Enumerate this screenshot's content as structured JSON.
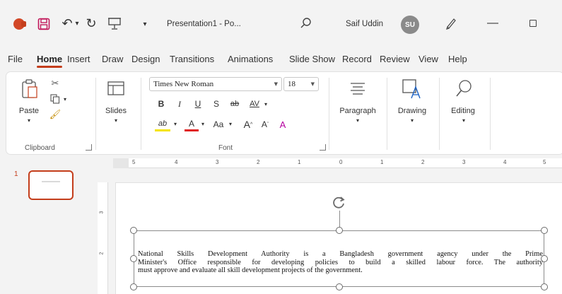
{
  "titlebar": {
    "doc_title": "Presentation1 - Po...",
    "user_name": "Saif Uddin",
    "user_initials": "SU",
    "icons": [
      "powerpoint-logo-icon",
      "save-icon",
      "undo-icon",
      "redo-icon",
      "presentation-icon",
      "search-icon",
      "pen-icon",
      "minimize-icon",
      "maximize-icon"
    ]
  },
  "tabs": [
    "File",
    "Home",
    "Insert",
    "Draw",
    "Design",
    "Transitions",
    "Animations",
    "Slide Show",
    "Record",
    "Review",
    "View",
    "Help"
  ],
  "active_tab": "Home",
  "accent_color": "#c43e1c",
  "ribbon": {
    "clipboard": {
      "paste": "Paste",
      "label": "Clipboard"
    },
    "slides": {
      "label": "Slides"
    },
    "font": {
      "font_name": "Times New Roman",
      "font_size": "18",
      "bold": "B",
      "italic": "I",
      "underline": "U",
      "shadow": "S",
      "strike": "ab",
      "spacing": "AV",
      "highlight": "ab",
      "font_color": "A",
      "change_case": "Aa",
      "grow": "A",
      "shrink": "A",
      "clear": "A",
      "label": "Font"
    },
    "paragraph": {
      "label": "Paragraph"
    },
    "drawing": {
      "label": "Drawing"
    },
    "editing": {
      "label": "Editing"
    }
  },
  "slide_panel": {
    "slide_number": "1"
  },
  "ruler": {
    "ticks": [
      "5",
      "4",
      "3",
      "2",
      "1",
      "0",
      "1",
      "2",
      "3",
      "4",
      "5"
    ],
    "vticks": [
      "3",
      "2"
    ]
  },
  "slide": {
    "text_lines": [
      "National Skills Development Authority is a Bangladesh government agency under the Prime",
      "Minister's Office responsible for developing policies to build a skilled labour force. The authority",
      "must approve and evaluate all skill development projects of the government."
    ]
  }
}
